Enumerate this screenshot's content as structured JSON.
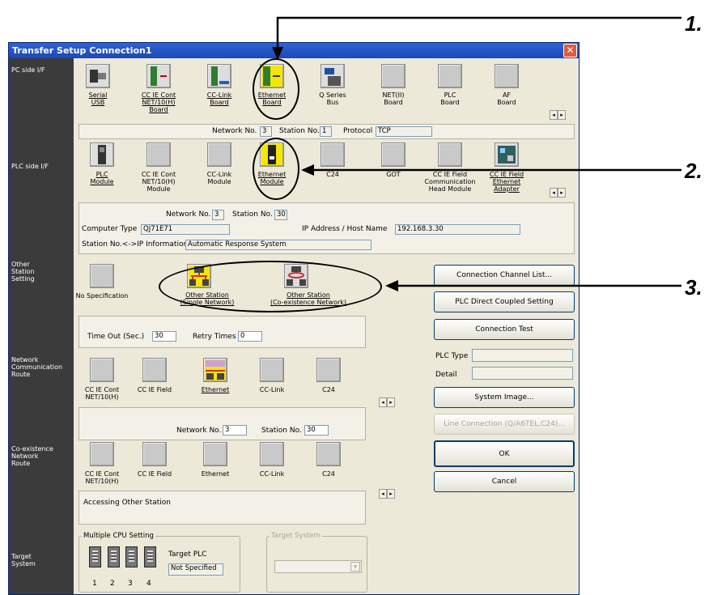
{
  "callouts": [
    "1.",
    "2.",
    "3."
  ],
  "window": {
    "title": "Transfer Setup Connection1",
    "close_glyph": "✕"
  },
  "sidebar": {
    "pc_side": "PC side I/F",
    "plc_side": "PLC side I/F",
    "other_station": "Other\nStation\nSetting",
    "network_route": "Network\nCommunication\nRoute",
    "coexistence_route": "Co-existence\nNetwork\nRoute",
    "target_system": "Target\nSystem"
  },
  "pc_side": {
    "items": [
      {
        "label": "Serial\nUSB",
        "icon": "serial-usb-icon",
        "selected": false
      },
      {
        "label": "CC IE Cont\nNET/10(H)\nBoard",
        "icon": "cc-ie-board-icon",
        "selected": false
      },
      {
        "label": "CC-Link\nBoard",
        "icon": "cc-link-board-icon",
        "selected": false
      },
      {
        "label": "Ethernet\nBoard",
        "icon": "ethernet-board-icon",
        "selected": true
      },
      {
        "label": "Q Series\nBus",
        "icon": "q-series-bus-icon",
        "selected": false
      },
      {
        "label": "NET(II)\nBoard",
        "icon": "net2-board-icon",
        "selected": false
      },
      {
        "label": "PLC\nBoard",
        "icon": "plc-board-icon",
        "selected": false
      },
      {
        "label": "AF\nBoard",
        "icon": "af-board-icon",
        "selected": false
      }
    ],
    "network_no_label": "Network No.",
    "network_no": "3",
    "station_no_label": "Station No.",
    "station_no": "1",
    "protocol_label": "Protocol",
    "protocol": "TCP"
  },
  "plc_side": {
    "items": [
      {
        "label": "PLC\nModule",
        "icon": "plc-module-icon"
      },
      {
        "label": "CC IE Cont\nNET/10(H)\nModule",
        "icon": "cc-ie-module-icon"
      },
      {
        "label": "CC-Link\nModule",
        "icon": "cc-link-module-icon"
      },
      {
        "label": "Ethernet\nModule",
        "icon": "ethernet-module-icon"
      },
      {
        "label": "C24",
        "icon": "c24-icon"
      },
      {
        "label": "GOT",
        "icon": "got-icon"
      },
      {
        "label": "CC IE Field\nCommunication\nHead Module",
        "icon": "cc-ie-field-head-icon"
      },
      {
        "label": "CC IE Field\nEthernet\nAdapter",
        "icon": "cc-ie-field-adapter-icon"
      }
    ],
    "network_no_label": "Network No.",
    "network_no": "3",
    "station_no_label": "Station No.",
    "station_no": "30",
    "computer_type_label": "Computer Type",
    "computer_type": "QJ71E71",
    "ip_label": "IP Address / Host Name",
    "ip": "192.168.3.30",
    "station_ip_label": "Station No.<->IP Information",
    "station_ip": "Automatic Response System"
  },
  "other_station": {
    "no_spec": "No Specification",
    "single": "Other Station\n(Single Network)",
    "coexist": "Other Station\n(Co-existence Network)",
    "timeout_label": "Time Out (Sec.)",
    "timeout": "30",
    "retry_label": "Retry Times",
    "retry": "0"
  },
  "network_route": {
    "items": [
      "CC IE Cont\nNET/10(H)",
      "CC IE Field",
      "Ethernet",
      "CC-Link",
      "C24"
    ],
    "network_no_label": "Network No.",
    "network_no": "3",
    "station_no_label": "Station No.",
    "station_no": "30"
  },
  "coexistence_route": {
    "items": [
      "CC IE Cont\nNET/10(H)",
      "CC IE Field",
      "Ethernet",
      "CC-Link",
      "C24"
    ],
    "status": "Accessing Other Station"
  },
  "target_system": {
    "multiple_cpu_label": "Multiple CPU Setting",
    "cpu_numbers": [
      "1",
      "2",
      "3",
      "4"
    ],
    "target_plc_label": "Target PLC",
    "target_plc": "Not Specified",
    "target_system_label": "Target System"
  },
  "buttons": {
    "channel_list": "Connection Channel List...",
    "direct_coupled": "PLC Direct Coupled Setting",
    "connection_test": "Connection Test",
    "system_image": "System Image...",
    "line_connection": "Line Connection (Q/A6TEL,C24)...",
    "ok": "OK",
    "cancel": "Cancel"
  },
  "plc_info": {
    "plc_type_label": "PLC Type",
    "plc_type": "",
    "detail_label": "Detail",
    "detail": ""
  }
}
